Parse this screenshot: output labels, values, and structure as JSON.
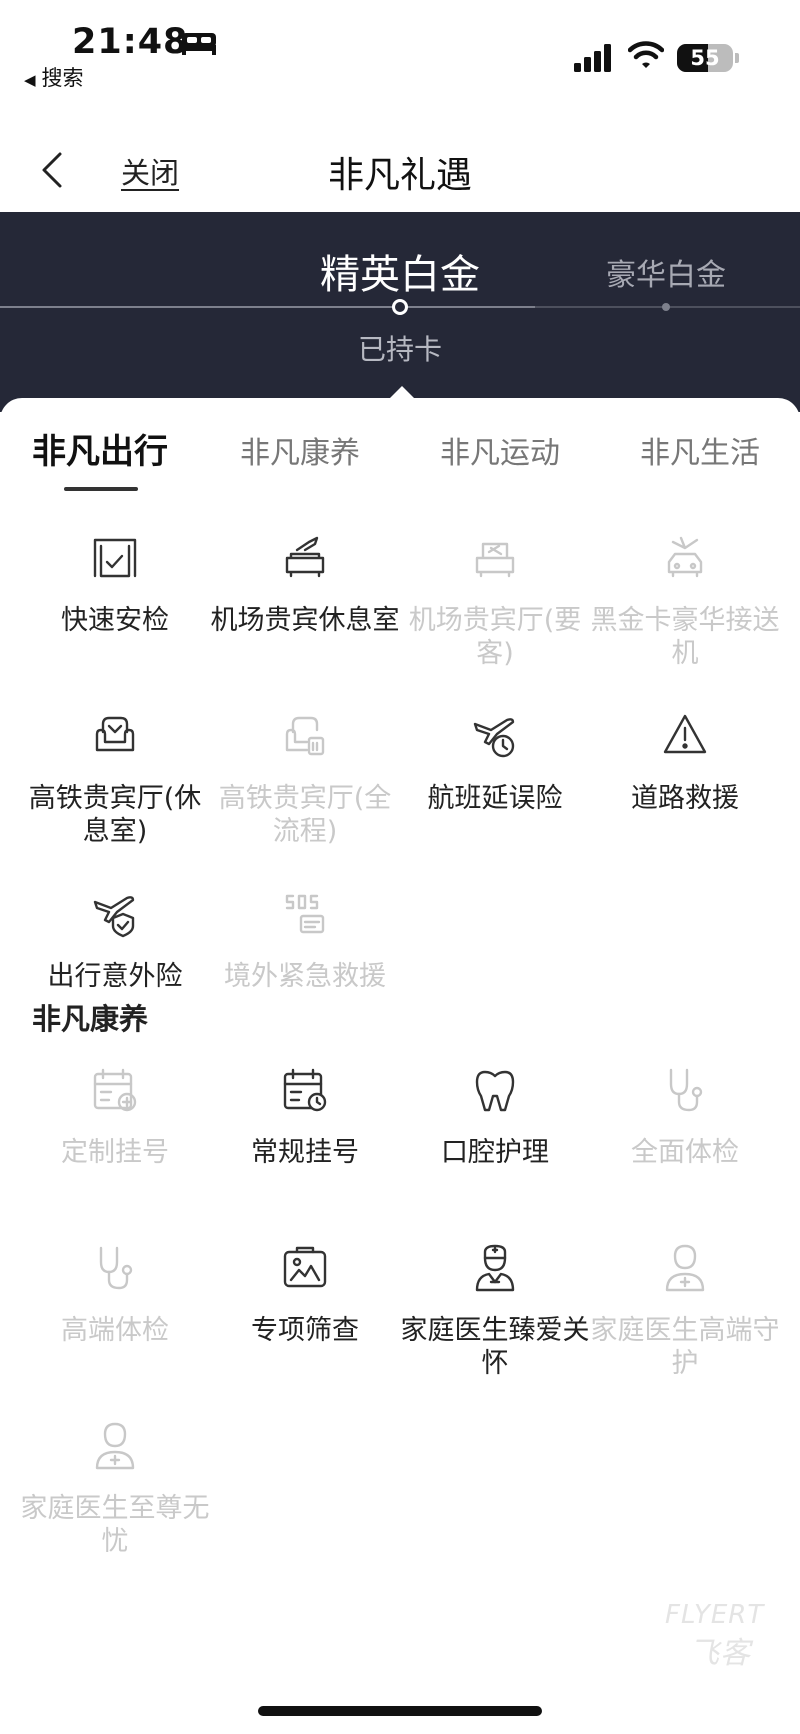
{
  "status_bar": {
    "time": "21:48",
    "back_app": "搜索",
    "battery": "55"
  },
  "nav": {
    "close_label": "关闭",
    "title": "非凡礼遇"
  },
  "tier": {
    "current": "精英白金",
    "next": "豪华白金",
    "status": "已持卡"
  },
  "tabs": [
    {
      "label": "非凡出行"
    },
    {
      "label": "非凡康养"
    },
    {
      "label": "非凡运动"
    },
    {
      "label": "非凡生活"
    }
  ],
  "travel_items": [
    {
      "label": "快速安检",
      "icon": "security-gate-icon",
      "enabled": true
    },
    {
      "label": "机场贵宾休息室",
      "icon": "lounge-sofa-icon",
      "enabled": true
    },
    {
      "label": "机场贵宾厅(要客)",
      "icon": "vip-lounge-icon",
      "enabled": false
    },
    {
      "label": "黑金卡豪华接送机",
      "icon": "car-plane-icon",
      "enabled": false
    },
    {
      "label": "高铁贵宾厅(休息室)",
      "icon": "armchair-icon",
      "enabled": true
    },
    {
      "label": "高铁贵宾厅(全流程)",
      "icon": "armchair-ticket-icon",
      "enabled": false
    },
    {
      "label": "航班延误险",
      "icon": "plane-clock-icon",
      "enabled": true
    },
    {
      "label": "道路救援",
      "icon": "warning-triangle-icon",
      "enabled": true
    },
    {
      "label": "出行意外险",
      "icon": "plane-shield-icon",
      "enabled": true
    },
    {
      "label": "境外紧急救援",
      "icon": "sos-icon",
      "enabled": false
    }
  ],
  "health_section_title": "非凡康养",
  "health_items": [
    {
      "label": "定制挂号",
      "icon": "calendar-plus-icon",
      "enabled": false
    },
    {
      "label": "常规挂号",
      "icon": "calendar-clock-icon",
      "enabled": true
    },
    {
      "label": "口腔护理",
      "icon": "tooth-icon",
      "enabled": true
    },
    {
      "label": "全面体检",
      "icon": "stethoscope-icon",
      "enabled": false
    },
    {
      "label": "高端体检",
      "icon": "stethoscope-icon",
      "enabled": false
    },
    {
      "label": "专项筛查",
      "icon": "xray-icon",
      "enabled": true
    },
    {
      "label": "家庭医生臻爱关怀",
      "icon": "doctor-icon",
      "enabled": true
    },
    {
      "label": "家庭医生高端守护",
      "icon": "nurse-icon",
      "enabled": false
    },
    {
      "label": "家庭医生至尊无忧",
      "icon": "nurse-icon",
      "enabled": false
    }
  ],
  "watermark": {
    "latin": "FLYERT",
    "cn": "飞客"
  }
}
